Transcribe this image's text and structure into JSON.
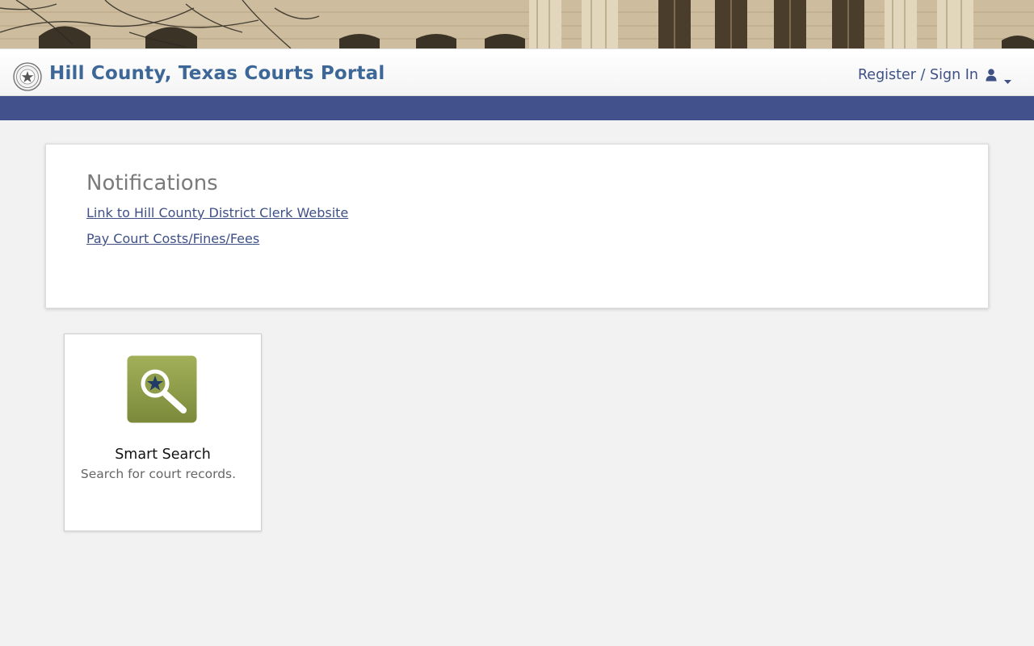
{
  "header": {
    "site_title": "Hill County, Texas Courts Portal",
    "signin_label": "Register / Sign In",
    "seal_icon": "county-seal-icon",
    "user_icon": "user-icon",
    "caret_icon": "caret-down-icon"
  },
  "colors": {
    "title": "#3d6797",
    "navbar": "#42518c",
    "link": "#3f5087",
    "search_tile_green": "#8d9c48",
    "search_star": "#1f3b66"
  },
  "notifications": {
    "title": "Notifications",
    "links": [
      "Link to Hill County District Clerk Website",
      "Pay Court Costs/Fines/Fees"
    ]
  },
  "tiles": [
    {
      "title": "Smart Search",
      "description": "Search for court records.",
      "icon": "magnifier-star-icon"
    }
  ]
}
